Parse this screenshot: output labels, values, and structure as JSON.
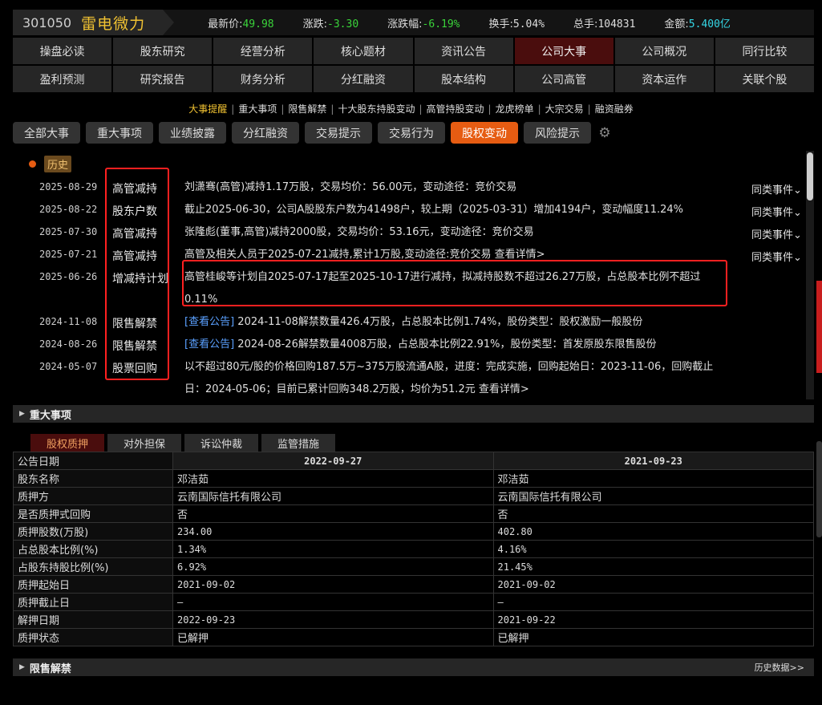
{
  "quote": {
    "code": "301050",
    "name": "雷电微力",
    "fields": [
      {
        "label": "最新价:",
        "value": "49.98",
        "color": "#3ad33a"
      },
      {
        "label": "涨跌:",
        "value": "-3.30",
        "color": "#3ad33a"
      },
      {
        "label": "涨跌幅:",
        "value": "-6.19%",
        "color": "#3ad33a"
      },
      {
        "label": "换手:",
        "value": "5.04%",
        "color": "#dddddd"
      },
      {
        "label": "总手:",
        "value": "104831",
        "color": "#dddddd"
      },
      {
        "label": "金额:",
        "value": "5.400亿",
        "color": "#35d7e6"
      }
    ]
  },
  "nav": {
    "row1": [
      "操盘必读",
      "股东研究",
      "经营分析",
      "核心题材",
      "资讯公告",
      "公司大事",
      "公司概况",
      "同行比较"
    ],
    "row2": [
      "盈利预测",
      "研究报告",
      "财务分析",
      "分红融资",
      "股本结构",
      "公司高管",
      "资本运作",
      "关联个股"
    ],
    "active": "公司大事"
  },
  "subnav": {
    "items": [
      "大事提醒",
      "重大事项",
      "限售解禁",
      "十大股东持股变动",
      "高管持股变动",
      "龙虎榜单",
      "大宗交易",
      "融资融券"
    ],
    "active": "大事提醒"
  },
  "filter_tabs": {
    "items": [
      "全部大事",
      "重大事项",
      "业绩披露",
      "分红融资",
      "交易提示",
      "交易行为",
      "股权变动",
      "风险提示"
    ],
    "active": "股权变动",
    "settings_icon": "gear-icon"
  },
  "events": {
    "history_label": "历史",
    "same_label": "同类事件",
    "rows": [
      {
        "date": "2025-08-29",
        "type": "高管减持",
        "desc": "刘潇骞(高管)减持1.17万股，交易均价：56.00元，变动途径：竞价交易",
        "same": true
      },
      {
        "date": "2025-08-22",
        "type": "股东户数",
        "desc": "截止2025-06-30，公司A股股东户数为41498户，较上期（2025-03-31）增加4194户，变动幅度11.24%",
        "same": true
      },
      {
        "date": "2025-07-30",
        "type": "高管减持",
        "desc": "张隆彪(董事,高管)减持2000股，交易均价：53.16元，变动途径：竞价交易",
        "same": true
      },
      {
        "date": "2025-07-21",
        "type": "高管减持",
        "desc": "高管及相关人员于2025-07-21减持,累计1万股,变动途径:竞价交易",
        "more": "查看详情>",
        "same": true
      },
      {
        "date": "2025-06-26",
        "type": "增减持计划",
        "desc": "高管桂峻等计划自2025-07-17起至2025-10-17进行减持，拟减持股数不超过26.27万股，占总股本比例不超过0.11%",
        "same": false
      },
      {
        "date": "2024-11-08",
        "type": "限售解禁",
        "link": "[查看公告]",
        "desc": "2024-11-08解禁数量426.4万股，占总股本比例1.74%，股份类型：股权激励一般股份",
        "same": false
      },
      {
        "date": "2024-08-26",
        "type": "限售解禁",
        "link": "[查看公告]",
        "desc": "2024-08-26解禁数量4008万股，占总股本比例22.91%，股份类型：首发原股东限售股份",
        "same": false
      },
      {
        "date": "2024-05-07",
        "type": "股票回购",
        "desc": "以不超过80元/股的价格回购187.5万~375万股流通A股，进度：完成实施，回购起始日：2023-11-06，回购截止日：2024-05-06；目前已累计回购348.2万股，均价为51.2元",
        "more": "查看详情>",
        "same": false
      }
    ]
  },
  "sections": {
    "major": "重大事项",
    "restricted": "限售解禁",
    "history_data": "历史数据>>"
  },
  "pledge_tabs": {
    "items": [
      "股权质押",
      "对外担保",
      "诉讼仲裁",
      "监管措施"
    ],
    "active": "股权质押"
  },
  "pledge_table": {
    "header_label": "公告日期",
    "columns": [
      "2022-09-27",
      "2021-09-23"
    ],
    "rows": [
      {
        "label": "股东名称",
        "values": [
          "邓洁茹",
          "邓洁茹"
        ]
      },
      {
        "label": "质押方",
        "values": [
          "云南国际信托有限公司",
          "云南国际信托有限公司"
        ]
      },
      {
        "label": "是否质押式回购",
        "values": [
          "否",
          "否"
        ]
      },
      {
        "label": "质押股数(万股)",
        "values": [
          "234.00",
          "402.80"
        ]
      },
      {
        "label": "占总股本比例(%)",
        "values": [
          "1.34%",
          "4.16%"
        ]
      },
      {
        "label": "占股东持股比例(%)",
        "values": [
          "6.92%",
          "21.45%"
        ]
      },
      {
        "label": "质押起始日",
        "values": [
          "2021-09-02",
          "2021-09-02"
        ]
      },
      {
        "label": "质押截止日",
        "values": [
          "—",
          "—"
        ]
      },
      {
        "label": "解押日期",
        "values": [
          "2022-09-23",
          "2021-09-22"
        ]
      },
      {
        "label": "质押状态",
        "values": [
          "已解押",
          "已解押"
        ]
      }
    ]
  }
}
